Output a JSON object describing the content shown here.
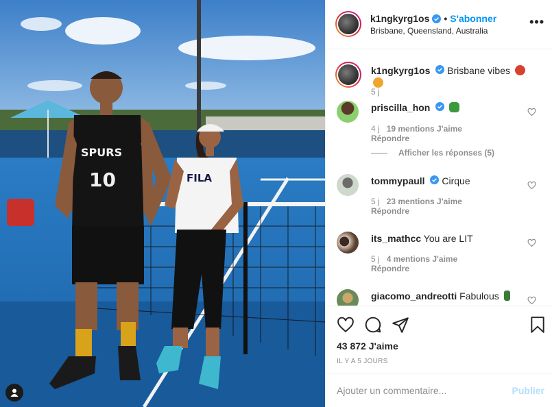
{
  "post": {
    "author": "k1ngkyrg1os",
    "follow_label": "S'abonner",
    "separator": "•",
    "location": "Brisbane, Queensland, Australia",
    "more_label": "•••"
  },
  "photo": {
    "tagged_icon": "person-icon",
    "jersey_text": "SPURS",
    "jersey_number": "10",
    "shirt_text": "FILA"
  },
  "caption": {
    "user": "k1ngkyrg1os",
    "text": "Brisbane vibes",
    "emojis": [
      "angry-face-emoji",
      "tiger-face-emoji"
    ],
    "time": "5 j"
  },
  "comments": [
    {
      "user": "priscilla_hon",
      "verified": true,
      "text": "",
      "emoji": "shamrock-emoji",
      "time": "4 j",
      "likes": "19 mentions J'aime",
      "reply": "Répondre",
      "show_replies": "Afficher les réponses (5)"
    },
    {
      "user": "tommypaull",
      "verified": true,
      "text": "Cirque",
      "time": "5 j",
      "likes": "23 mentions J'aime",
      "reply": "Répondre"
    },
    {
      "user": "its_mathcc",
      "verified": false,
      "text": "You are LIT",
      "time": "5 j",
      "likes": "4 mentions J'aime",
      "reply": "Répondre"
    },
    {
      "user": "giacomo_andreotti",
      "verified": false,
      "text": "Fabulous",
      "emoji": "bottle-emoji"
    }
  ],
  "actions": {
    "like_icon": "heart-icon",
    "comment_icon": "comment-icon",
    "share_icon": "paper-plane-icon",
    "save_icon": "bookmark-icon",
    "likes_count": "43 872 J'aime",
    "posted_ago": "IL Y A 5 JOURS"
  },
  "add_comment": {
    "placeholder": "Ajouter un commentaire...",
    "publish_label": "Publier"
  },
  "colors": {
    "accent": "#0095f6",
    "publish_disabled": "#b2dffc",
    "court_blue": "#1f6fb8",
    "sky": "#6fa3d8"
  }
}
